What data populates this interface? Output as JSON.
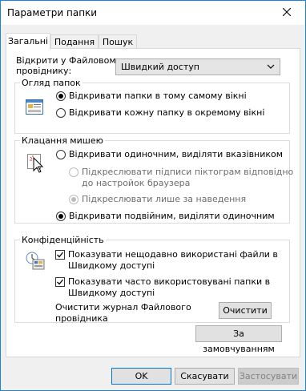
{
  "window": {
    "title": "Параметри папки"
  },
  "tabs": [
    {
      "label": "Загальні"
    },
    {
      "label": "Подання"
    },
    {
      "label": "Пошук"
    }
  ],
  "open_in": {
    "label_line1": "Відкрити у Файловому",
    "label_line2": "провіднику:",
    "value": "Швидкий доступ"
  },
  "browse": {
    "title": "Огляд папок",
    "option_same": "Відкривати папки в тому самому вікні",
    "option_new": "Відкривати кожну папку в окремому вікні"
  },
  "click": {
    "title": "Клацання мишею",
    "single": "Відкривати одиночним, виділяти вказівником",
    "underline_browser_1": "Підкреслювати підписи піктограм відповідно",
    "underline_browser_2": "до настройок браузера",
    "underline_hover": "Підкреслювати лише за наведення",
    "double": "Відкривати подвійним, виділяти одиночним"
  },
  "privacy": {
    "title": "Конфіденційність",
    "recent_files_1": "Показувати нещодавно використані файли в",
    "recent_files_2": "Швидкому доступі",
    "frequent_folders_1": "Показувати часто використовувані папки в",
    "frequent_folders_2": "Швидкому доступі",
    "clear_history_1": "Очистити журнал Файлового",
    "clear_history_2": "провідника",
    "clear_button": "Очистити"
  },
  "restore_defaults": "За замовчуванням",
  "footer": {
    "ok": "OK",
    "cancel": "Скасувати",
    "apply": "Застосувати"
  },
  "colors": {
    "accent": "#0078d7",
    "check": "#000000"
  }
}
